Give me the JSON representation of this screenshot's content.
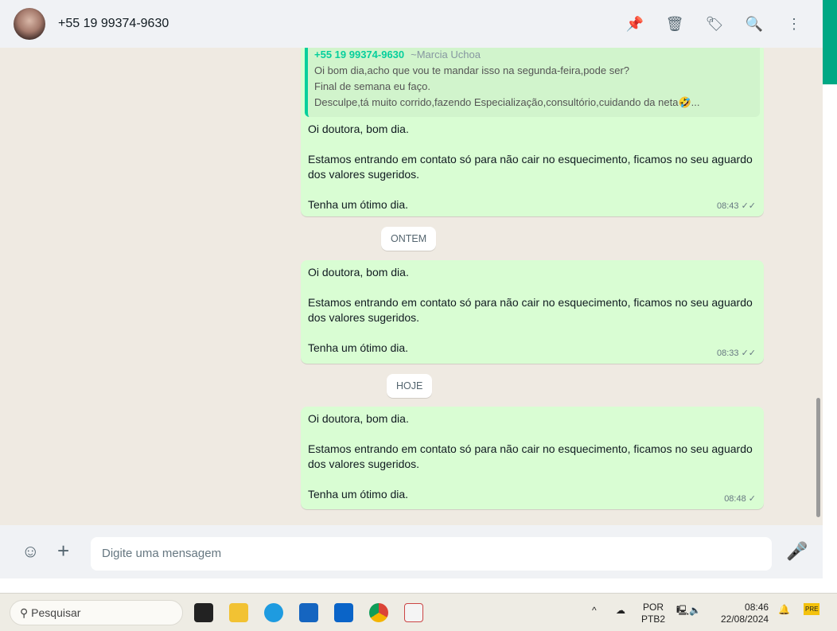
{
  "header": {
    "contact": "+55 19 99374-9630",
    "icons": [
      "pin-icon",
      "delete-icon",
      "label-icon",
      "search-icon",
      "menu-icon"
    ]
  },
  "messages": [
    {
      "quote": {
        "sender": "+55 19 99374-9630",
        "name": "~Marcia Uchoa",
        "lines": [
          "Oi bom dia,acho que vou te mandar isso na segunda-feira,pode ser?",
          "Final de semana eu faço.",
          "Desculpe,tá muito corrido,fazendo Especialização,consultório,cuidando da neta🤣..."
        ]
      },
      "lines": [
        "Oi doutora, bom dia.",
        "",
        "Estamos entrando em contato só para não cair no esquecimento, ficamos no seu aguardo dos valores sugeridos.",
        "",
        "Tenha um ótimo dia."
      ],
      "time": "08:43",
      "ticks": "✓✓"
    },
    {
      "lines": [
        "Oi doutora, bom dia.",
        "",
        "Estamos entrando em contato só para não cair no esquecimento, ficamos no seu aguardo dos valores sugeridos.",
        "",
        "Tenha um ótimo dia."
      ],
      "time": "08:33",
      "ticks": "✓✓"
    },
    {
      "lines": [
        "Oi doutora, bom dia.",
        "",
        "Estamos entrando em contato só para não cair no esquecimento, ficamos no seu aguardo dos valores sugeridos.",
        "",
        "Tenha um ótimo dia."
      ],
      "time": "08:48",
      "ticks": "✓"
    }
  ],
  "dates": {
    "yesterday": "ONTEM",
    "today": "HOJE"
  },
  "composer": {
    "placeholder": "Digite uma mensagem"
  },
  "taskbar": {
    "search": "Pesquisar",
    "lang1": "POR",
    "lang2": "PTB2",
    "time": "08:46",
    "date": "22/08/2024",
    "copilot_badge": "PRE"
  }
}
